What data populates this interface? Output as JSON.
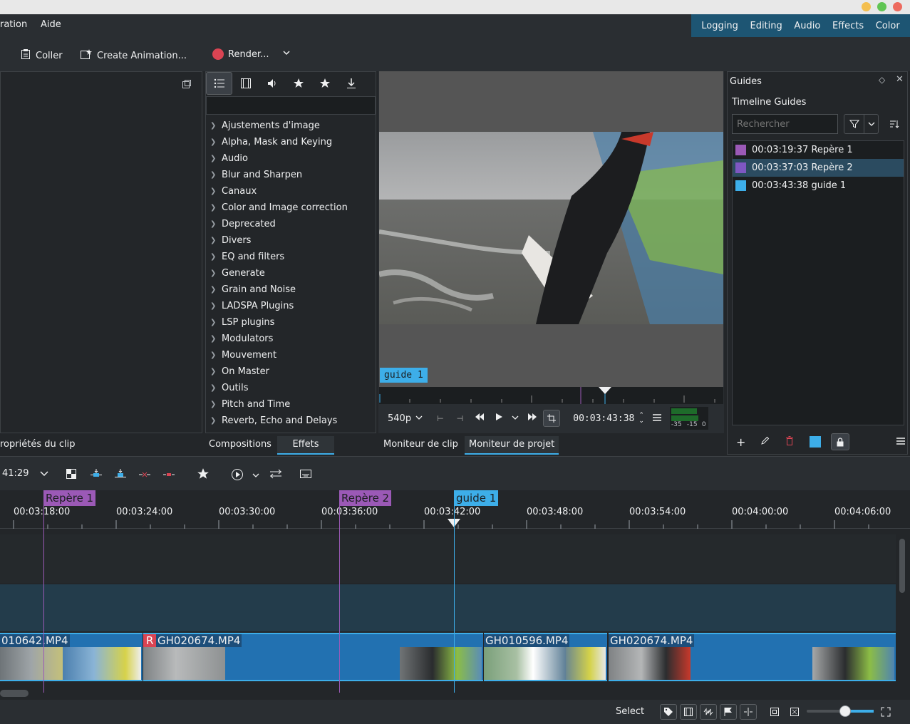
{
  "menu": {
    "items": [
      "ration",
      "Aide"
    ]
  },
  "workspaces": [
    "Logging",
    "Editing",
    "Audio",
    "Effects",
    "Color"
  ],
  "toolbar": {
    "paste_label": "Coller",
    "create_animation_label": "Create Animation...",
    "render_label": "Render..."
  },
  "effects": {
    "categories": [
      "Ajustements d'image",
      "Alpha, Mask and Keying",
      "Audio",
      "Blur and Sharpen",
      "Canaux",
      "Color and Image correction",
      "Deprecated",
      "Divers",
      "EQ and filters",
      "Generate",
      "Grain and Noise",
      "LADSPA Plugins",
      "LSP plugins",
      "Modulators",
      "Mouvement",
      "On Master",
      "Outils",
      "Pitch and Time",
      "Reverb, Echo and Delays"
    ]
  },
  "monitor": {
    "guide_tag": "guide 1",
    "resolution": "540p",
    "timecode": "00:03:43:38",
    "meter_labels": [
      "-35",
      "-15",
      "0"
    ]
  },
  "guides": {
    "panel_title": "Guides",
    "section_title": "Timeline Guides",
    "search_placeholder": "Rechercher",
    "items": [
      {
        "label": "00:03:19:37 Repère 1",
        "color": "#9b59b6"
      },
      {
        "label": "00:03:37:03 Repère 2",
        "color": "#7e57c2"
      },
      {
        "label": "00:03:43:38 guide 1",
        "color": "#3daee9"
      }
    ]
  },
  "tabs": {
    "clip_props": "ropriétés du clip",
    "compositions": "Compositions",
    "effets": "Effets",
    "clip_monitor": "Moniteur de clip",
    "project_monitor": "Moniteur de projet"
  },
  "timeline": {
    "timecode": "41:29",
    "guide_labels": [
      "Repère 1",
      "Repère 2",
      "guide 1"
    ],
    "ticks": [
      "00:03:18:00",
      "00:03:24:00",
      "00:03:30:00",
      "00:03:36:00",
      "00:03:42:00",
      "00:03:48:00",
      "00:03:54:00",
      "00:04:00:00",
      "00:04:06:00"
    ],
    "clips": [
      "010642.MP4",
      "GH020674.MP4",
      "GH010596.MP4",
      "GH020674.MP4"
    ],
    "clip_badge": "R"
  },
  "status": {
    "mode": "Select"
  },
  "colors": {
    "accent": "#3daee9",
    "clip": "#2271b1",
    "record": "#da4453"
  }
}
